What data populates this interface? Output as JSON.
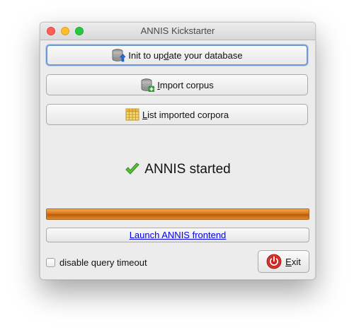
{
  "window": {
    "title": "ANNIS Kickstarter"
  },
  "buttons": {
    "init": {
      "label_pre": "Init to up",
      "label_mnemonic": "d",
      "label_post": "ate your database",
      "icon": "database-update-icon"
    },
    "import": {
      "label_pre": "",
      "label_mnemonic": "I",
      "label_post": "mport corpus",
      "icon": "database-add-icon"
    },
    "list": {
      "label_pre": "",
      "label_mnemonic": "L",
      "label_post": "ist imported corpora",
      "icon": "table-icon"
    },
    "exit": {
      "label_pre": "",
      "label_mnemonic": "E",
      "label_post": "xit",
      "icon": "power-icon"
    }
  },
  "status": {
    "text": "ANNIS started",
    "icon": "checkmark-icon"
  },
  "progress": {
    "value": 1.0,
    "color": "#d9741a"
  },
  "frontend_link": {
    "label": "Launch ANNIS frontend"
  },
  "options": {
    "disable_query_timeout_label": "disable query timeout",
    "disable_query_timeout_checked": false
  },
  "colors": {
    "link": "#0000ee",
    "focus_ring": "#6f98d6",
    "progress_orange": "#d9741a"
  }
}
